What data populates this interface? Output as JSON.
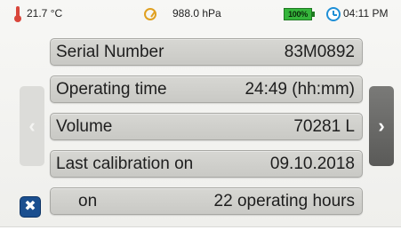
{
  "status_bar": {
    "temperature": "21.7 °C",
    "pressure": "988.0 hPa",
    "battery": "100%",
    "time": "04:11 PM"
  },
  "rows": [
    {
      "label": "Serial Number",
      "value": "83M0892"
    },
    {
      "label": "Operating time",
      "value": "24:49 (hh:mm)"
    },
    {
      "label": "Volume",
      "value": "70281 L"
    },
    {
      "label": "Last calibration on",
      "value": "09.10.2018"
    },
    {
      "label": "on",
      "value": "22 operating hours"
    }
  ],
  "nav": {
    "prev_glyph": "‹",
    "next_glyph": "›"
  },
  "close_glyph": "✖",
  "colors": {
    "row_bg": "#d0d0cc",
    "battery": "#35b53b",
    "clock": "#1f8fd6",
    "gauge": "#e0a020",
    "thermometer": "#d9463b",
    "close_button": "#1b4f8f"
  }
}
